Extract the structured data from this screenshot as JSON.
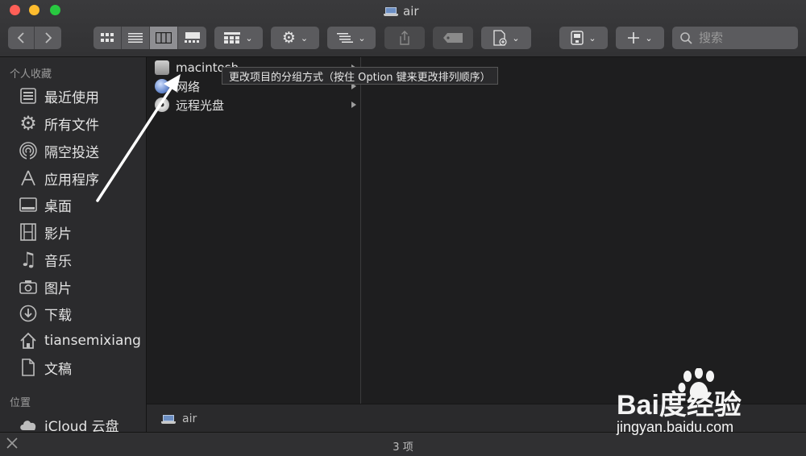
{
  "window": {
    "title": "air"
  },
  "toolbar": {
    "search_placeholder": "搜索"
  },
  "sidebar": {
    "favorites_header": "个人收藏",
    "items": [
      {
        "label": "最近使用",
        "icon": "recents-icon"
      },
      {
        "label": "所有文件",
        "icon": "gear-icon"
      },
      {
        "label": "隔空投送",
        "icon": "airdrop-icon"
      },
      {
        "label": "应用程序",
        "icon": "applications-icon"
      },
      {
        "label": "桌面",
        "icon": "desktop-icon"
      },
      {
        "label": "影片",
        "icon": "movies-icon"
      },
      {
        "label": "音乐",
        "icon": "music-icon"
      },
      {
        "label": "图片",
        "icon": "pictures-icon"
      },
      {
        "label": "下载",
        "icon": "downloads-icon"
      },
      {
        "label": "tiansemixiang",
        "icon": "home-icon"
      },
      {
        "label": "文稿",
        "icon": "documents-icon"
      }
    ],
    "locations_header": "位置",
    "locations": [
      {
        "label": "iCloud 云盘",
        "icon": "cloud-icon"
      }
    ]
  },
  "column": {
    "items": [
      {
        "label": "macintosh",
        "icon": "hard-drive-icon"
      },
      {
        "label": "网络",
        "icon": "network-globe-icon"
      },
      {
        "label": "远程光盘",
        "icon": "disc-icon"
      }
    ]
  },
  "tooltip": {
    "text": "更改项目的分组方式（按住 Option 键来更改排列顺序）"
  },
  "pathbar": {
    "label": "air"
  },
  "statusbar": {
    "text": "3 项"
  },
  "watermark": {
    "brand": "Bai度经验",
    "url": "jingyan.baidu.com"
  },
  "colors": {
    "close": "#ff5f57",
    "minimize": "#febc2e",
    "maximize": "#28c840",
    "arrow": "#ffffff"
  }
}
